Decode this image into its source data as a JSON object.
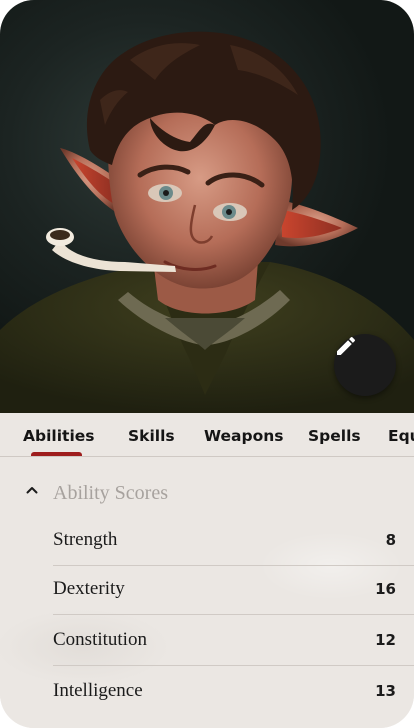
{
  "portrait": {
    "alt_description_icon": "character-portrait-image",
    "edit_icon": "pencil-icon"
  },
  "tabs": [
    {
      "label": "Abilities",
      "active": true
    },
    {
      "label": "Skills",
      "active": false
    },
    {
      "label": "Weapons",
      "active": false
    },
    {
      "label": "Spells",
      "active": false
    },
    {
      "label": "Equ",
      "active": false
    }
  ],
  "section": {
    "title": "Ability Scores",
    "expanded": true,
    "chevron_icon": "chevron-up-icon"
  },
  "scores": [
    {
      "name": "Strength",
      "value": "8"
    },
    {
      "name": "Dexterity",
      "value": "16"
    },
    {
      "name": "Constitution",
      "value": "12"
    },
    {
      "name": "Intelligence",
      "value": "13"
    }
  ],
  "colors": {
    "accent": "#9e1d1d",
    "background": "#ebe7e3",
    "text": "#1b1b1b",
    "muted": "#a7a29e"
  }
}
